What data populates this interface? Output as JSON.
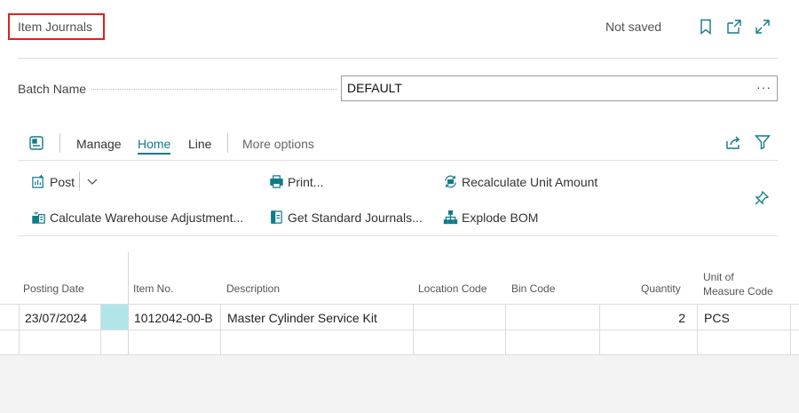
{
  "header": {
    "title": "Item Journals",
    "status": "Not saved"
  },
  "batch": {
    "label": "Batch Name",
    "value": "DEFAULT",
    "more_label": "···"
  },
  "action_bar": {
    "tabs": [
      {
        "label": "Manage",
        "active": false
      },
      {
        "label": "Home",
        "active": true
      },
      {
        "label": "Line",
        "active": false
      }
    ],
    "more_options": "More options"
  },
  "actions": {
    "post": "Post",
    "print": "Print...",
    "recalculate": "Recalculate Unit Amount",
    "calc_warehouse": "Calculate Warehouse Adjustment...",
    "get_standard": "Get Standard Journals...",
    "explode_bom": "Explode BOM"
  },
  "grid": {
    "columns": {
      "posting_date": "Posting Date",
      "item_no": "Item No.",
      "description": "Description",
      "location_code": "Location Code",
      "bin_code": "Bin Code",
      "quantity": "Quantity",
      "uom_line1": "Unit of",
      "uom_line2": "Measure Code"
    },
    "rows": [
      {
        "posting_date": "23/07/2024",
        "item_no": "1012042-00-B",
        "description": "Master Cylinder Service Kit",
        "location_code": "",
        "bin_code": "",
        "quantity": "2",
        "uom": "PCS"
      }
    ]
  },
  "colors": {
    "accent": "#0f7b8a",
    "highlight_border": "#e02020",
    "selected_cell": "#b0e6ea"
  }
}
